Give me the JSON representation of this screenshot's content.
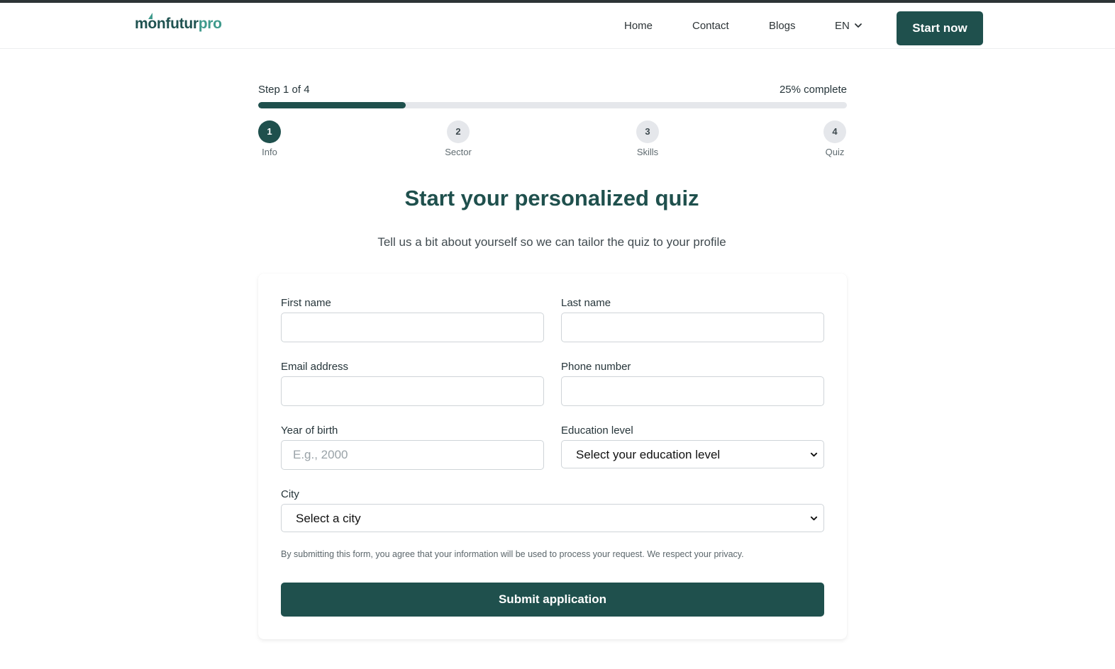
{
  "header": {
    "logo_part1": "monfutur",
    "logo_part2": "pro",
    "nav": [
      "Home",
      "Contact",
      "Blogs"
    ],
    "language": "EN",
    "cta": "Start now"
  },
  "progress": {
    "step_text": "Step 1 of 4",
    "percent_text": "25% complete",
    "fraction": 0.25,
    "steps": [
      {
        "number": "1",
        "label": "Info",
        "active": true
      },
      {
        "number": "2",
        "label": "Sector",
        "active": false
      },
      {
        "number": "3",
        "label": "Skills",
        "active": false
      },
      {
        "number": "4",
        "label": "Quiz",
        "active": false
      }
    ]
  },
  "intro": {
    "title": "Start your personalized quiz",
    "subtitle": "Tell us a bit about yourself so we can tailor the quiz to your profile"
  },
  "form": {
    "first_name_label": "First name",
    "first_name_value": "",
    "last_name_label": "Last name",
    "last_name_value": "",
    "email_label": "Email address",
    "email_value": "",
    "phone_label": "Phone number",
    "phone_value": "",
    "year_label": "Year of birth",
    "year_placeholder": "E.g., 2000",
    "education_label": "Education level",
    "education_selected": "Select your education level",
    "city_label": "City",
    "city_selected": "Select a city",
    "consent": "By submitting this form, you agree that your information will be used to process your request. We respect your privacy.",
    "submit": "Submit application"
  },
  "colors": {
    "brand": "#1f504d",
    "accent": "#3f9a8c",
    "track": "#e5e7eb"
  }
}
